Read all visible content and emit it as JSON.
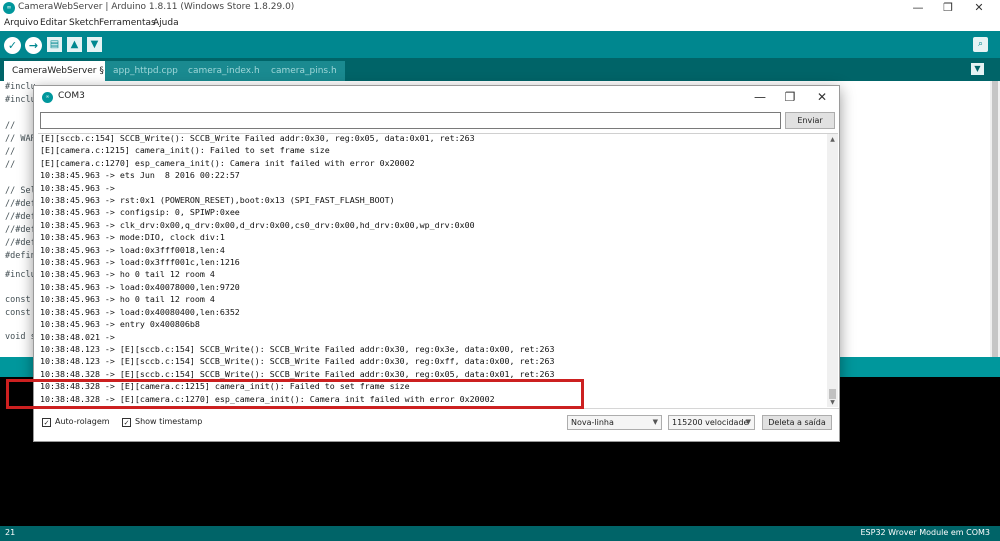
{
  "window": {
    "title": "CameraWebServer | Arduino 1.8.11 (Windows Store 1.8.29.0)",
    "logo": "arduino-logo",
    "controls": [
      "—",
      "❐",
      "✕"
    ]
  },
  "menu": [
    "Arquivo",
    "Editar",
    "Sketch",
    "Ferramentas",
    "Ajuda"
  ],
  "toolbar": {
    "verify": "✓",
    "upload": "→",
    "new": "▤",
    "open": "▲",
    "save": "▼",
    "serial_monitor": "⌕"
  },
  "tabs": [
    "CameraWebServer §",
    "app_httpd.cpp",
    "camera_index.h",
    "camera_pins.h"
  ],
  "tab_menu_icon": "▼",
  "editor_lines": [
    "#inclu",
    "#inclu",
    "",
    "//",
    "// WAR",
    "//",
    "//",
    "",
    "// Sel",
    "//#def",
    "//#def",
    "//#def",
    "//#def",
    "#defin",
    "",
    "#inclu",
    "",
    "const",
    "const",
    "",
    "void s"
  ],
  "status": {
    "line_number": "21",
    "board": "ESP32 Wrover Module em COM3"
  },
  "serial_monitor": {
    "title": "COM3",
    "input_value": "",
    "send_label": "Enviar",
    "output_lines": [
      "[E][sccb.c:154] SCCB_Write(): SCCB_Write Failed addr:0x30, reg:0x05, data:0x01, ret:263",
      "[E][camera.c:1215] camera_init(): Failed to set frame size",
      "[E][camera.c:1270] esp_camera_init(): Camera init failed with error 0x20002",
      "10:38:45.963 -> ets Jun  8 2016 00:22:57",
      "10:38:45.963 ->",
      "10:38:45.963 -> rst:0x1 (POWERON_RESET),boot:0x13 (SPI_FAST_FLASH_BOOT)",
      "10:38:45.963 -> configsip: 0, SPIWP:0xee",
      "10:38:45.963 -> clk_drv:0x00,q_drv:0x00,d_drv:0x00,cs0_drv:0x00,hd_drv:0x00,wp_drv:0x00",
      "10:38:45.963 -> mode:DIO, clock div:1",
      "10:38:45.963 -> load:0x3fff0018,len:4",
      "10:38:45.963 -> load:0x3fff001c,len:1216",
      "10:38:45.963 -> ho 0 tail 12 room 4",
      "10:38:45.963 -> load:0x40078000,len:9720",
      "10:38:45.963 -> ho 0 tail 12 room 4",
      "10:38:45.963 -> load:0x40080400,len:6352",
      "10:38:45.963 -> entry 0x400806b8",
      "10:38:48.021 ->",
      "10:38:48.123 -> [E][sccb.c:154] SCCB_Write(): SCCB_Write Failed addr:0x30, reg:0x3e, data:0x00, ret:263",
      "10:38:48.123 -> [E][sccb.c:154] SCCB_Write(): SCCB_Write Failed addr:0x30, reg:0xff, data:0x00, ret:263",
      "10:38:48.328 -> [E][sccb.c:154] SCCB_Write(): SCCB_Write Failed addr:0x30, reg:0x05, data:0x01, ret:263",
      "10:38:48.328 -> [E][camera.c:1215] camera_init(): Failed to set frame size",
      "10:38:48.328 -> [E][camera.c:1270] esp_camera_init(): Camera init failed with error 0x20002"
    ],
    "autoscroll": {
      "label": "Auto-rolagem",
      "checked": true
    },
    "show_timestamp": {
      "label": "Show timestamp",
      "checked": true
    },
    "line_ending": "Nova-linha",
    "baud_rate": "115200 velocidade",
    "clear_label": "Deleta a saída"
  },
  "colors": {
    "toolbar": "#00878f",
    "tabs_bar": "#006468",
    "message_bar": "#00979c",
    "console": "#000000",
    "highlight": "#cc2020"
  }
}
